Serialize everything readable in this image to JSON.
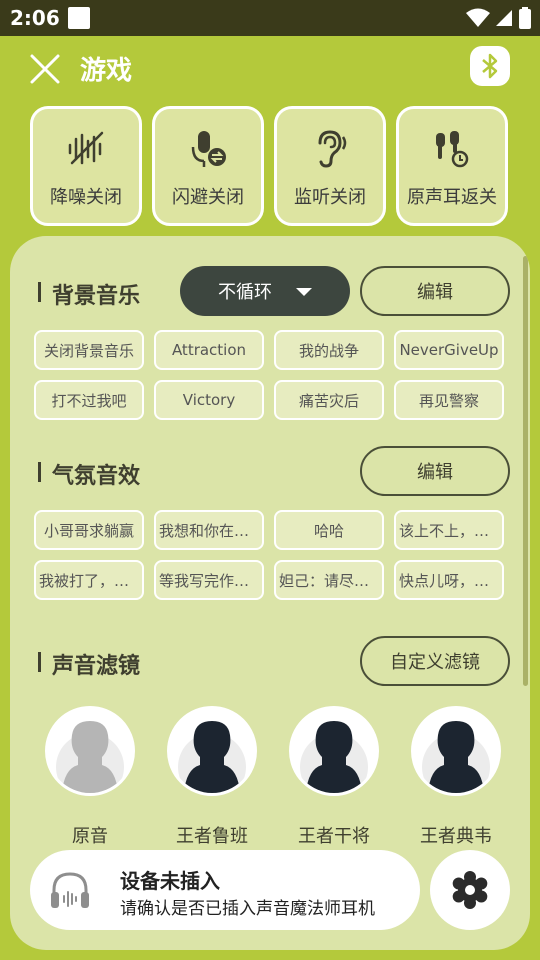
{
  "status": {
    "time": "2:06"
  },
  "header": {
    "title": "游戏",
    "close_icon": "close-icon",
    "bluetooth_icon": "bluetooth-icon"
  },
  "tiles": [
    {
      "label": "降噪关闭",
      "icon": "noise-reduction-off-icon"
    },
    {
      "label": "闪避关闭",
      "icon": "mic-dodge-icon"
    },
    {
      "label": "监听关闭",
      "icon": "ear-monitor-icon"
    },
    {
      "label": "原声耳返关",
      "icon": "earphone-return-icon"
    }
  ],
  "bgm": {
    "title": "背景音乐",
    "loop_mode": "不循环",
    "edit_label": "编辑",
    "tracks": [
      "关闭背景音乐",
      "Attraction",
      "我的战争",
      "NeverGiveUp",
      "打不过我吧",
      "Victory",
      "痛苦灾后",
      "再见警察"
    ]
  },
  "atmosphere": {
    "title": "气氛音效",
    "edit_label": "编辑",
    "effects": [
      "小哥哥求躺赢",
      "我想和你在一…",
      "哈哈",
      "该上不上，越…",
      "我被打了，快…",
      "等我写完作业…",
      "妲己：请尽情…",
      "快点儿呀，我…"
    ]
  },
  "filters": {
    "title": "声音滤镜",
    "custom_label": "自定义滤镜",
    "items": [
      {
        "name": "原音",
        "style": "grey"
      },
      {
        "name": "王者鲁班",
        "style": "dark"
      },
      {
        "name": "王者干将",
        "style": "dark"
      },
      {
        "name": "王者典韦",
        "style": "dark"
      }
    ]
  },
  "device": {
    "title": "设备未插入",
    "subtitle": "请确认是否已插入声音魔法师耳机",
    "icon": "headphones-icon"
  },
  "settings_icon": "gear-icon",
  "colors": {
    "background": "#b4c93b",
    "panel": "#dbe4a8",
    "dark_button": "#3d463f",
    "chip": "#e7ecc0"
  }
}
